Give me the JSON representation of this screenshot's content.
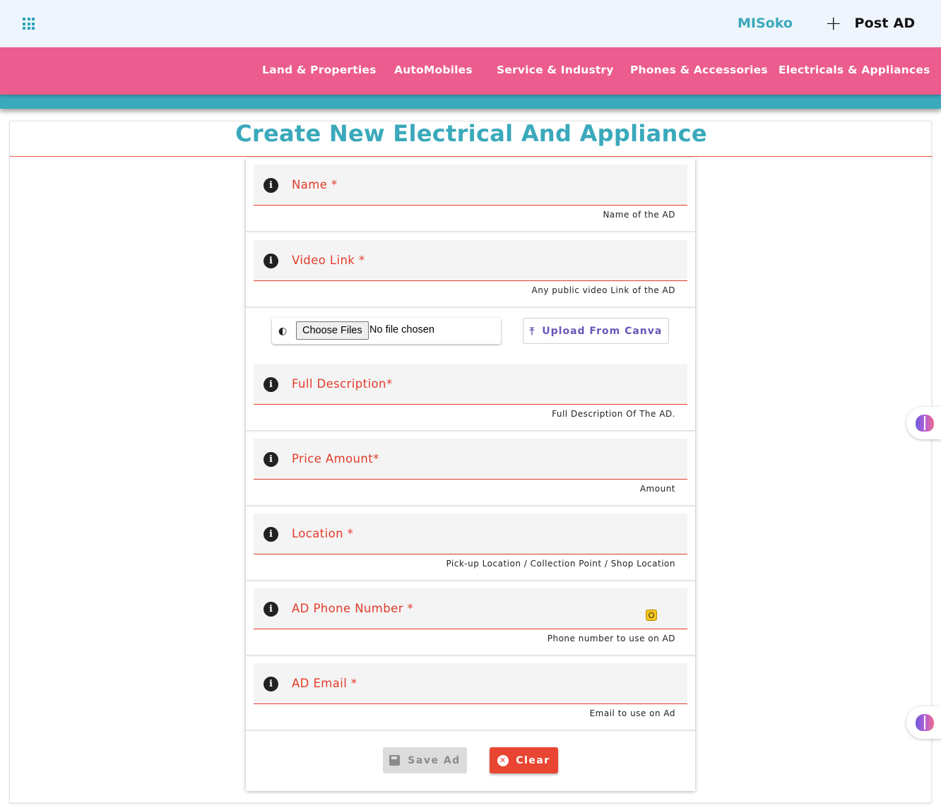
{
  "header": {
    "brand": "MISoko",
    "post_ad_icon": "+",
    "post_ad_label": "Post AD"
  },
  "nav": {
    "items": [
      {
        "label": "Land & Properties"
      },
      {
        "label": "AutoMobiles"
      },
      {
        "label": "Service & Industry"
      },
      {
        "label": "Phones & Accessories"
      },
      {
        "label": "Electricals & Appliances"
      }
    ]
  },
  "page": {
    "title": "Create New Electrical And Appliance"
  },
  "form": {
    "fields": [
      {
        "label": "Name *",
        "hint": "Name of the AD"
      },
      {
        "label": "Video Link *",
        "hint": "Any public video Link of the AD"
      },
      {
        "label": "Full Description*",
        "hint": "Full Description Of The AD."
      },
      {
        "label": "Price Amount*",
        "hint": "Amount"
      },
      {
        "label": "Location *",
        "hint": "Pick-up Location / Collection Point / Shop Location"
      },
      {
        "label": "AD Phone Number *",
        "hint": "Phone number to use on AD"
      },
      {
        "label": "AD Email *",
        "hint": "Email to use on Ad"
      }
    ],
    "file": {
      "choose_label": "Choose Files",
      "status": "No file chosen",
      "canva_label": "Upload From Canva"
    },
    "save_label": "Save Ad",
    "clear_label": "Clear"
  },
  "icons": {
    "apps": "apps-grid-icon",
    "info": "info-icon",
    "attach": "paperclip-icon",
    "upload": "upload-icon",
    "save": "floppy-disk-icon",
    "clear": "cancel-circle-icon",
    "assistant": "brain-icon",
    "autofill": "fingerprint-icon"
  },
  "colors": {
    "brand_teal": "#3aa9bb",
    "nav_pink": "#ec5c8e",
    "error_red": "#e33b2b",
    "clear_red": "#e84632",
    "canva_purple": "#6a55b8"
  }
}
